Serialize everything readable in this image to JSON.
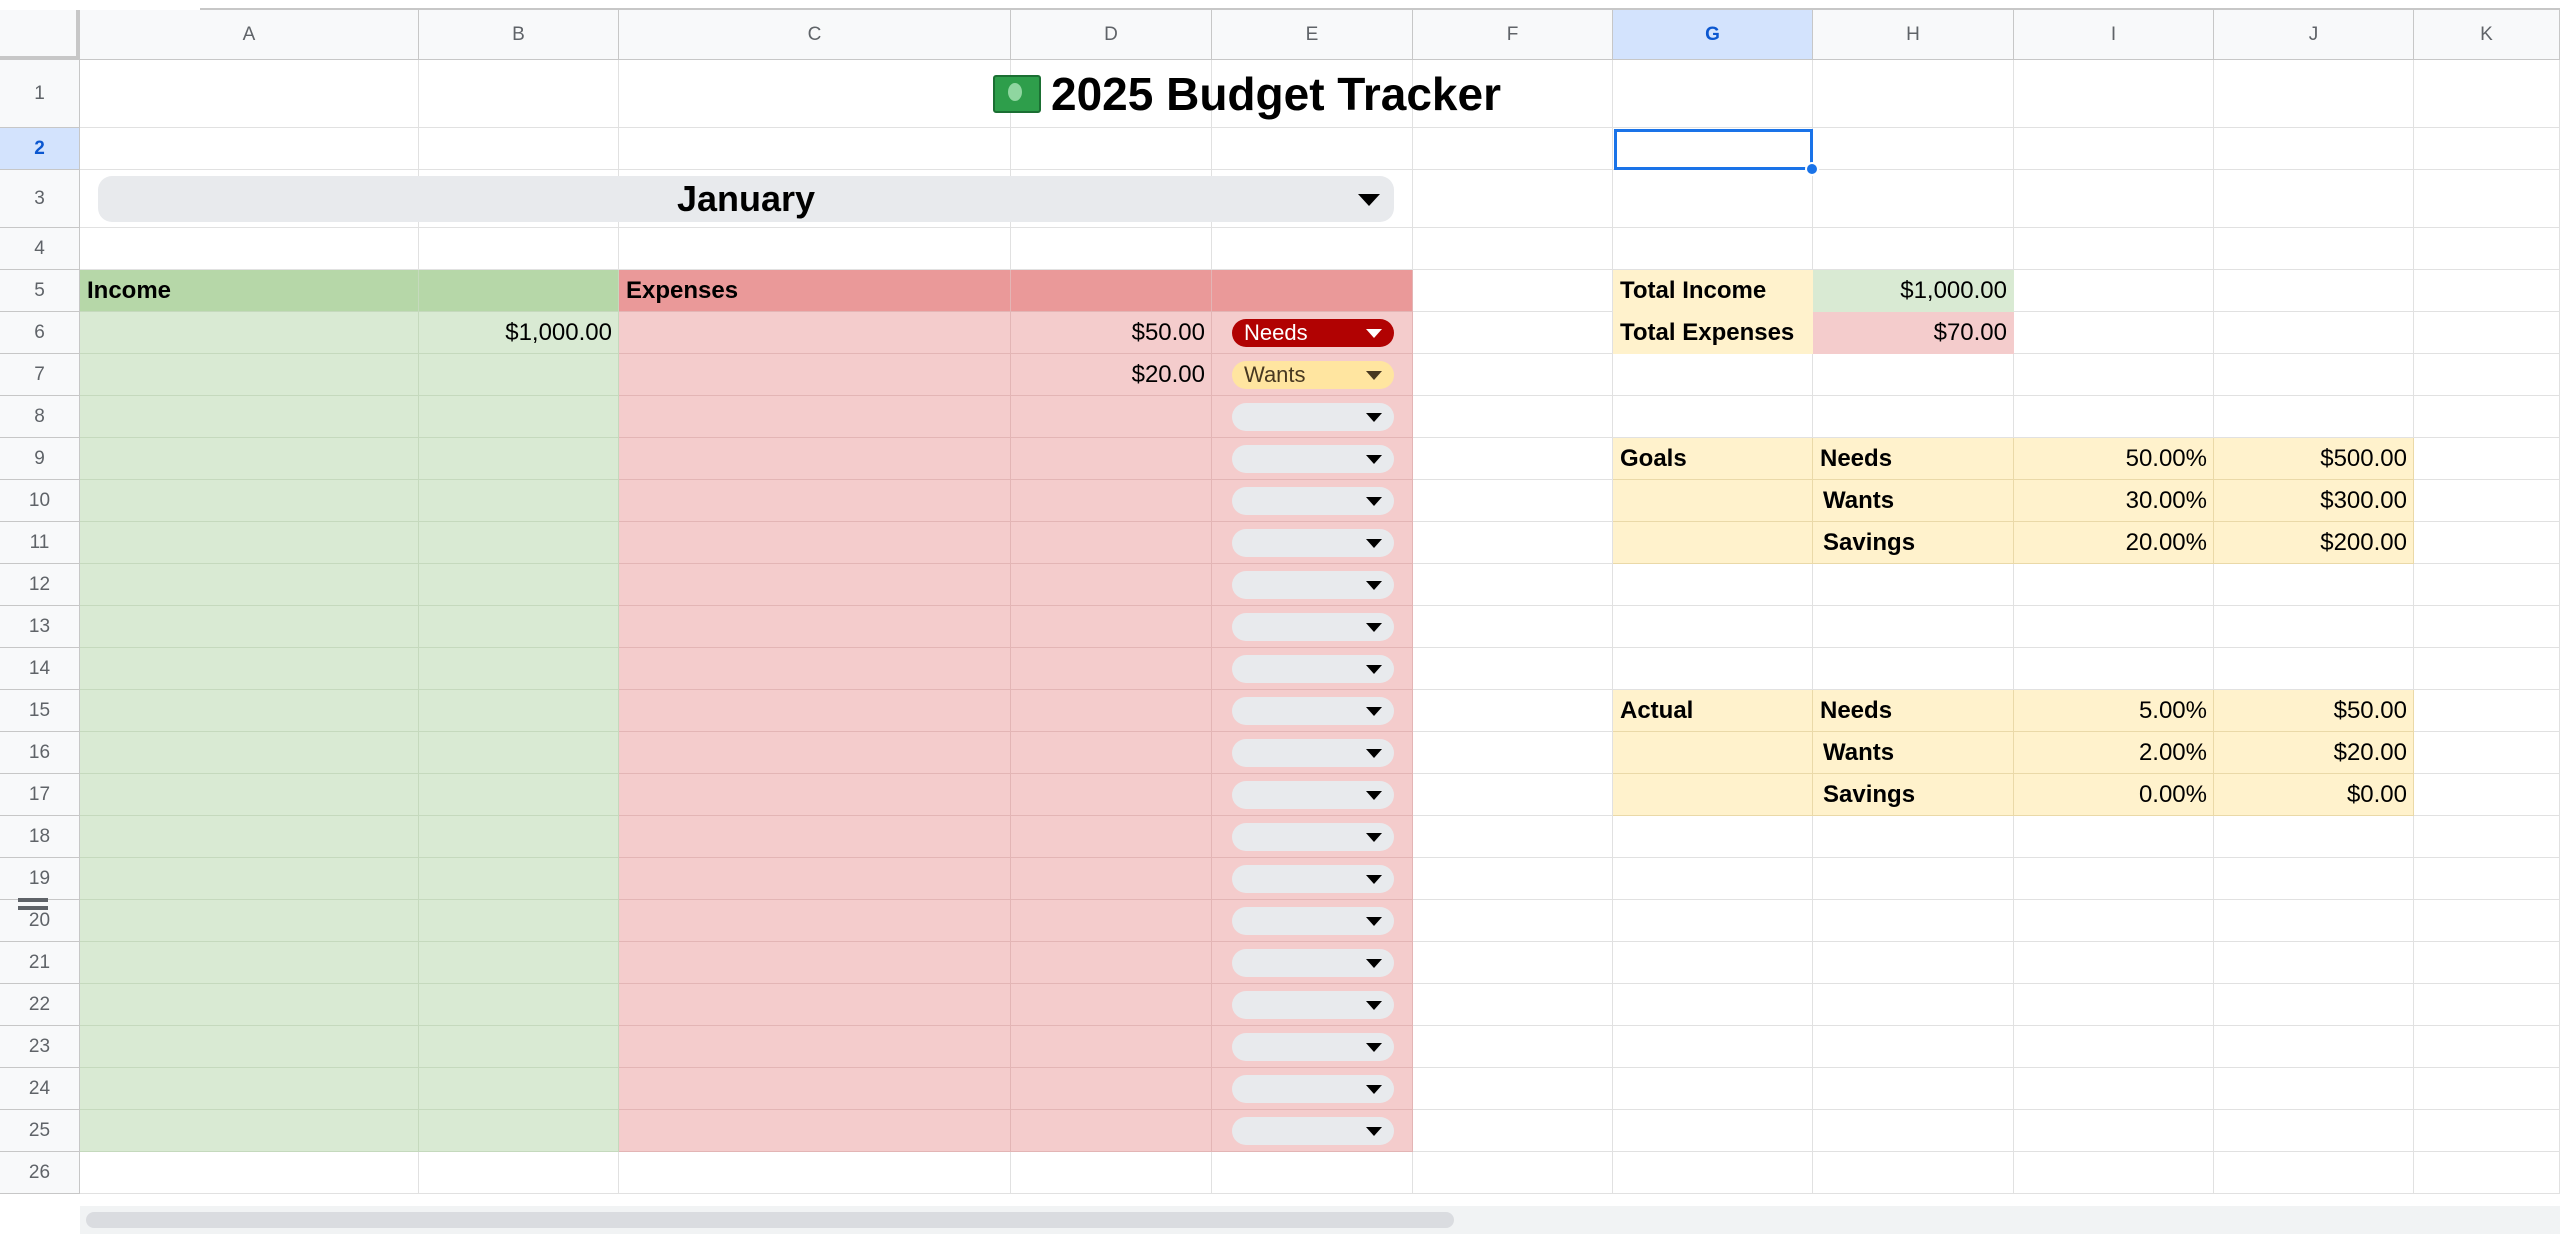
{
  "columns": [
    "A",
    "B",
    "C",
    "D",
    "E",
    "F",
    "G",
    "H",
    "I",
    "J",
    "K"
  ],
  "rows": [
    "1",
    "2",
    "3",
    "4",
    "5",
    "6",
    "7",
    "8",
    "9",
    "10",
    "11",
    "12",
    "13",
    "14",
    "15",
    "16",
    "17",
    "18",
    "19",
    "20",
    "21",
    "22",
    "23",
    "24",
    "25",
    "26"
  ],
  "selected_cell": "G2",
  "title": "2025 Budget Tracker",
  "title_icon": "money-bill-icon",
  "month_selector": {
    "value": "January"
  },
  "income": {
    "header": "Income",
    "amounts": [
      "$1,000.00"
    ]
  },
  "expenses": {
    "header": "Expenses",
    "amounts": [
      "$50.00",
      "$20.00"
    ],
    "categories": [
      "Needs",
      "Wants"
    ]
  },
  "summary": {
    "total_income_label": "Total Income",
    "total_income_value": "$1,000.00",
    "total_expenses_label": "Total Expenses",
    "total_expenses_value": "$70.00"
  },
  "goals": {
    "label": "Goals",
    "rows": [
      {
        "category": "Needs",
        "percent": "50.00%",
        "amount": "$500.00"
      },
      {
        "category": "Wants",
        "percent": "30.00%",
        "amount": "$300.00"
      },
      {
        "category": "Savings",
        "percent": "20.00%",
        "amount": "$200.00"
      }
    ]
  },
  "actual": {
    "label": "Actual",
    "rows": [
      {
        "category": "Needs",
        "percent": "5.00%",
        "amount": "$50.00"
      },
      {
        "category": "Wants",
        "percent": "2.00%",
        "amount": "$20.00"
      },
      {
        "category": "Savings",
        "percent": "0.00%",
        "amount": "$0.00"
      }
    ]
  },
  "colors": {
    "income_header": "#b6d7a8",
    "income_fill": "#d9ead3",
    "expense_header": "#ea9999",
    "expense_fill": "#f4cccc",
    "summary_label_fill": "#fff2cc",
    "selection": "#1a73e8",
    "needs_chip": "#b10202",
    "wants_chip": "#ffe5a0"
  }
}
